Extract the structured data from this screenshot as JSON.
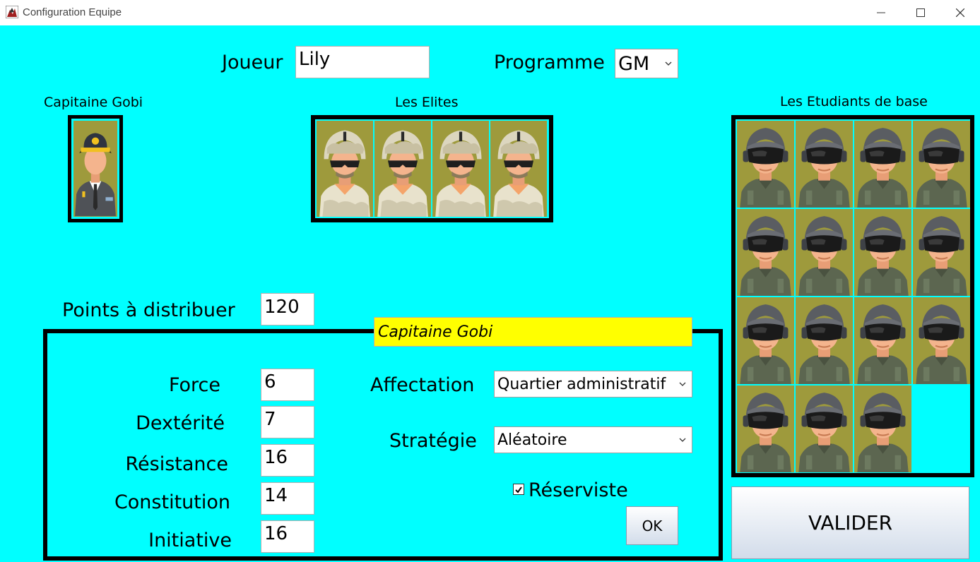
{
  "window": {
    "title": "Configuration Equipe",
    "minimize_icon": "minimize-icon",
    "maximize_icon": "maximize-icon",
    "close_icon": "close-icon"
  },
  "header": {
    "joueur_label": "Joueur",
    "joueur_value": "Lily",
    "programme_label": "Programme",
    "programme_value": "GM"
  },
  "captain": {
    "label": "Capitaine Gobi"
  },
  "elites": {
    "label": "Les Elites",
    "count": 4
  },
  "students": {
    "label": "Les Etudiants de base",
    "count": 15
  },
  "points": {
    "label": "Points à distribuer",
    "value": "120"
  },
  "selected": {
    "name": "Capitaine Gobi",
    "highlight_color": "#ffff00"
  },
  "stats": [
    {
      "label": "Force",
      "value": "6"
    },
    {
      "label": "Dextérité",
      "value": "7"
    },
    {
      "label": "Résistance",
      "value": "16"
    },
    {
      "label": "Constitution",
      "value": "14"
    },
    {
      "label": "Initiative",
      "value": "16"
    }
  ],
  "affectation": {
    "label": "Affectation",
    "value": "Quartier administratif"
  },
  "strategie": {
    "label": "Stratégie",
    "value": "Aléatoire"
  },
  "reserviste": {
    "label": "Réserviste",
    "checked": true
  },
  "buttons": {
    "ok": "OK",
    "valider": "VALIDER"
  },
  "colors": {
    "background": "#00ffff",
    "tile": "#9e9a3c"
  }
}
